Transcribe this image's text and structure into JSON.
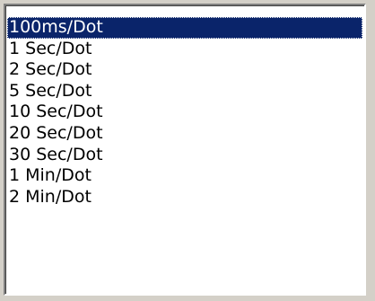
{
  "listbox": {
    "selected_index": 0,
    "items": [
      {
        "label": "100ms/Dot"
      },
      {
        "label": "1 Sec/Dot"
      },
      {
        "label": "2 Sec/Dot"
      },
      {
        "label": "5 Sec/Dot"
      },
      {
        "label": "10 Sec/Dot"
      },
      {
        "label": "20 Sec/Dot"
      },
      {
        "label": "30 Sec/Dot"
      },
      {
        "label": "1 Min/Dot"
      },
      {
        "label": "2 Min/Dot"
      }
    ]
  },
  "colors": {
    "selection_background": "#0a246a",
    "selection_text": "#ffffff",
    "list_background": "#ffffff",
    "window_background": "#d4d0c8"
  }
}
